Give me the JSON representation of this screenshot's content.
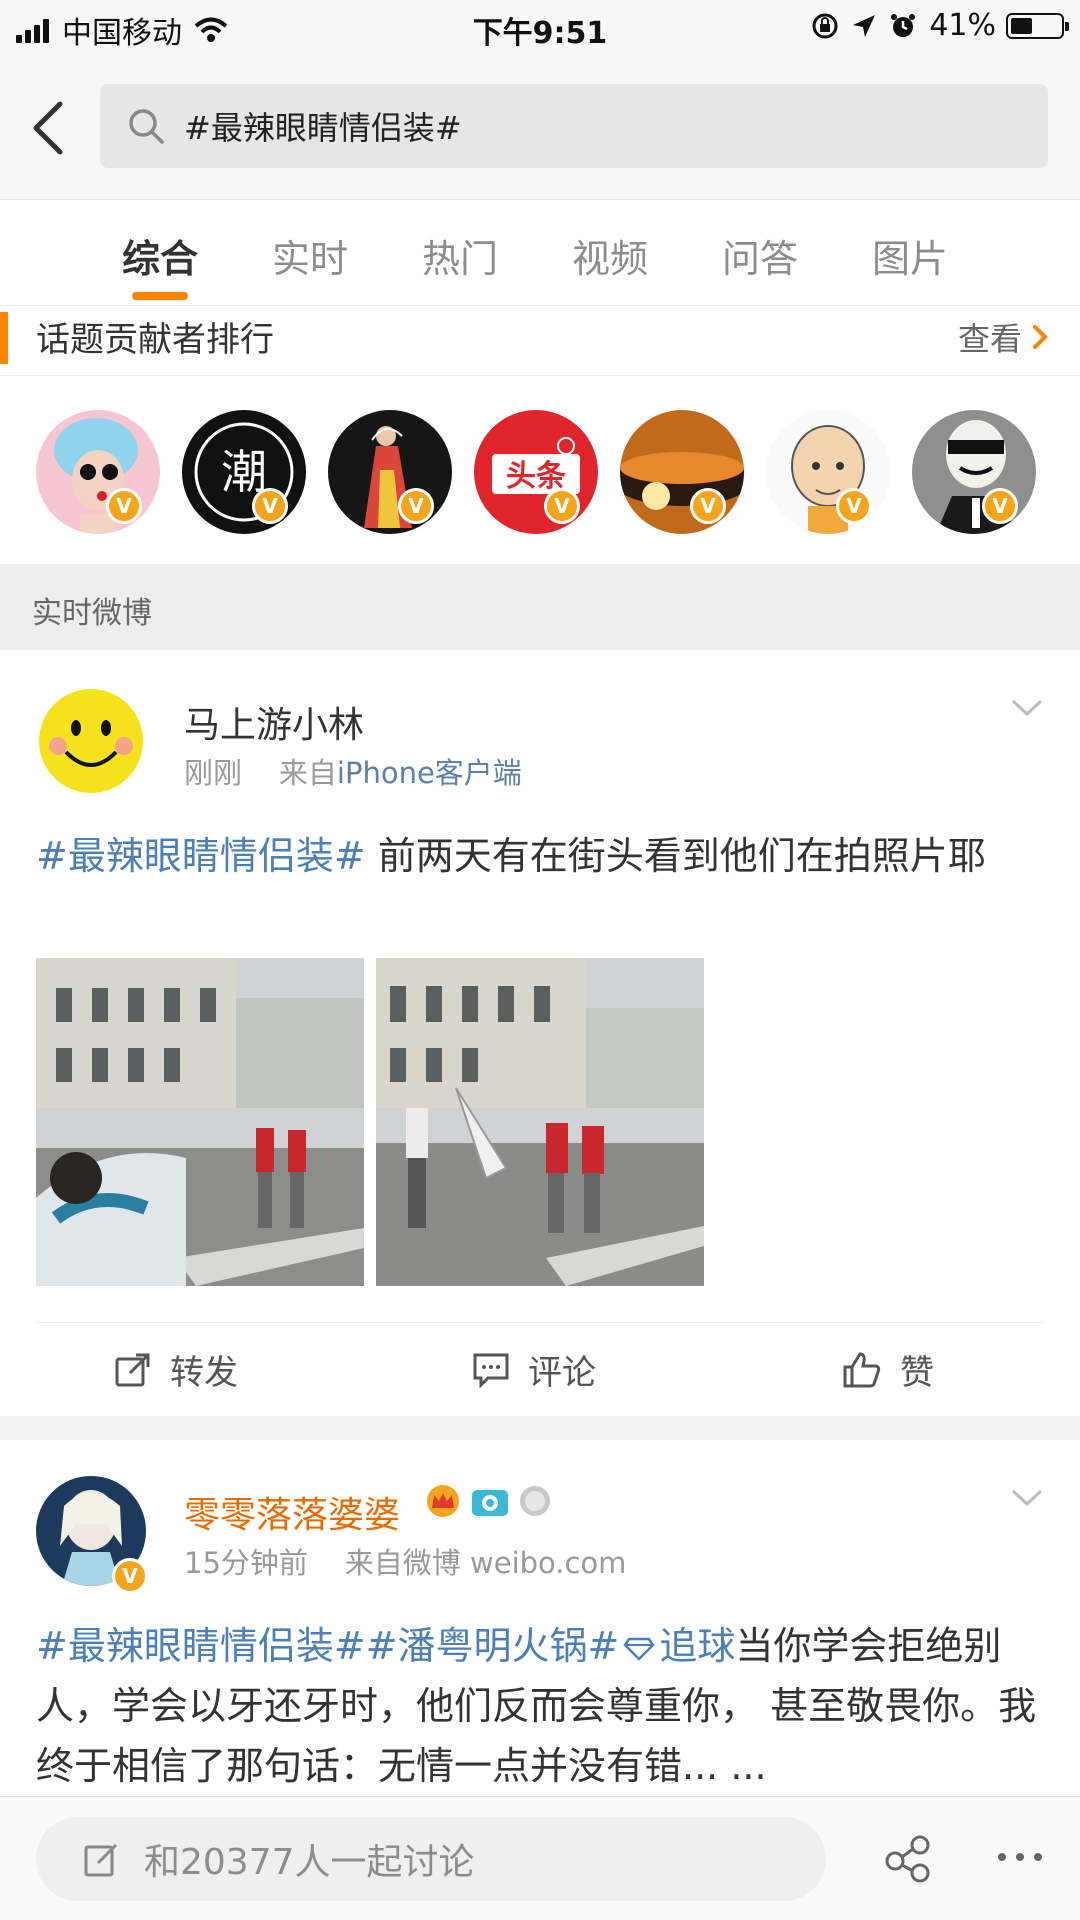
{
  "status_bar": {
    "carrier": "中国移动",
    "time": "下午9:51",
    "battery": "41%",
    "battery_level": 0.41
  },
  "search": {
    "query": "#最辣眼睛情侣装#"
  },
  "tabs": [
    {
      "label": "综合",
      "active": true
    },
    {
      "label": "实时",
      "active": false
    },
    {
      "label": "热门",
      "active": false
    },
    {
      "label": "视频",
      "active": false
    },
    {
      "label": "问答",
      "active": false
    },
    {
      "label": "图片",
      "active": false
    }
  ],
  "contributors": {
    "title": "话题贡献者排行",
    "view_label": "查看",
    "avatar_labels": [
      "潮",
      "头条"
    ],
    "verified_mark": "V"
  },
  "section_label": "实时微博",
  "posts": [
    {
      "username": "马上游小林",
      "time": "刚刚",
      "source_prefix": "来自",
      "source": "iPhone客户端",
      "topic": "#最辣眼睛情侣装#",
      "text": " 前两天有在街头看到他们在拍照片耶",
      "actions": {
        "repost": "转发",
        "comment": "评论",
        "like": "赞"
      }
    },
    {
      "username": "零零落落婆婆",
      "time": "15分钟前",
      "source_prefix": "来自微博",
      "source": "weibo.com",
      "topics": [
        "#最辣眼睛情侣装#",
        "#潘粤明火锅#",
        "追球"
      ],
      "text": "当你学会拒绝别人，学会以牙还牙时，他们反而会尊重你， 甚至敬畏你。我终于相信了那句话：无情一点并没有错... ..."
    }
  ],
  "bottom_bar": {
    "placeholder": "和20377人一起讨论"
  },
  "colors": {
    "accent": "#ff8200",
    "topic_link": "#4c7fb8",
    "verified_badge": "#f4a51c",
    "username_member": "#e86b00"
  }
}
